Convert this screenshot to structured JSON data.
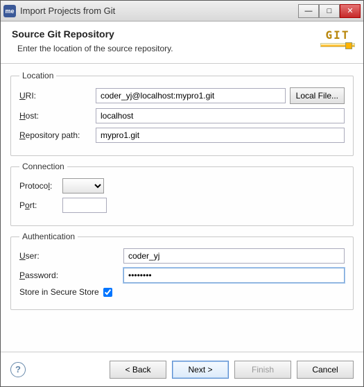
{
  "window": {
    "title": "Import Projects from Git",
    "icon": "me"
  },
  "header": {
    "title": "Source Git Repository",
    "subtitle": "Enter the location of the source repository.",
    "git_label": "GIT"
  },
  "location": {
    "legend": "Location",
    "uri_label": "URI:",
    "uri_value": "coder_yj@localhost:mypro1.git",
    "host_label": "Host:",
    "host_value": "localhost",
    "repo_label": "Repository path:",
    "repo_value": "mypro1.git",
    "local_file_btn": "Local File..."
  },
  "connection": {
    "legend": "Connection",
    "protocol_label": "Protocol:",
    "protocol_value": "",
    "port_label": "Port:",
    "port_value": ""
  },
  "auth": {
    "legend": "Authentication",
    "user_label": "User:",
    "user_value": "coder_yj",
    "password_label": "Password:",
    "password_value": "••••••••",
    "store_label": "Store in Secure Store",
    "store_checked": true
  },
  "footer": {
    "back": "< Back",
    "next": "Next >",
    "finish": "Finish",
    "cancel": "Cancel"
  }
}
